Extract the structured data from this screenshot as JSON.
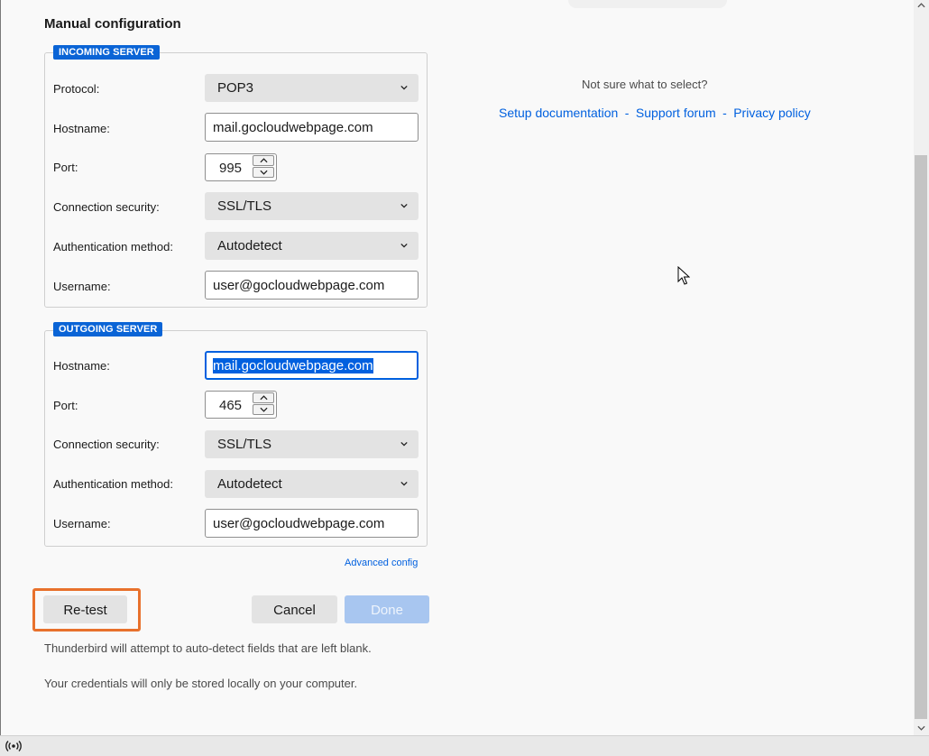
{
  "heading": "Manual configuration",
  "incoming": {
    "legend": "INCOMING SERVER",
    "protocol": {
      "label": "Protocol:",
      "value": "POP3"
    },
    "hostname": {
      "label": "Hostname:",
      "value": "mail.gocloudwebpage.com"
    },
    "port": {
      "label": "Port:",
      "value": "995"
    },
    "security": {
      "label": "Connection security:",
      "value": "SSL/TLS"
    },
    "auth": {
      "label": "Authentication method:",
      "value": "Autodetect"
    },
    "username": {
      "label": "Username:",
      "value": "user@gocloudwebpage.com"
    }
  },
  "outgoing": {
    "legend": "OUTGOING SERVER",
    "hostname": {
      "label": "Hostname:",
      "value": "mail.gocloudwebpage.com"
    },
    "port": {
      "label": "Port:",
      "value": "465"
    },
    "security": {
      "label": "Connection security:",
      "value": "SSL/TLS"
    },
    "auth": {
      "label": "Authentication method:",
      "value": "Autodetect"
    },
    "username": {
      "label": "Username:",
      "value": "user@gocloudwebpage.com"
    }
  },
  "advanced_link": "Advanced config",
  "buttons": {
    "retest": "Re-test",
    "cancel": "Cancel",
    "done": "Done"
  },
  "notes": {
    "autodetect": "Thunderbird will attempt to auto-detect fields that are left blank.",
    "credentials": "Your credentials will only be stored locally on your computer."
  },
  "help": {
    "question": "Not sure what to select?",
    "setup_doc": "Setup documentation",
    "sep1": "-",
    "support": "Support forum",
    "sep2": "-",
    "privacy": "Privacy policy"
  },
  "colors": {
    "accent": "#0060df",
    "highlight": "#e8712c",
    "legend_bg": "#0a64d6",
    "done_disabled": "#a8c6f0"
  },
  "icons": {
    "dropdown": "chevron-down-icon",
    "spin_up": "chevron-up-icon",
    "spin_down": "chevron-down-icon",
    "cursor": "mouse-pointer-icon",
    "status": "broadcast-icon"
  }
}
